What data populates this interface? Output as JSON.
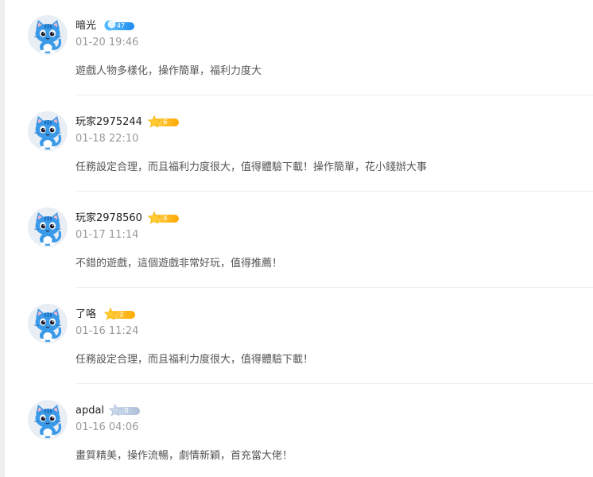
{
  "comments": [
    {
      "username": "暗光",
      "level": "47",
      "badge_style": "blue",
      "timestamp": "01-20 19:46",
      "text": "遊戲人物多樣化，操作簡單，福利力度大"
    },
    {
      "username": "玩家2975244",
      "level": "6",
      "badge_style": "gold",
      "timestamp": "01-18 22:10",
      "text": "任務設定合理，而且福利力度很大，值得體驗下載！操作簡單，花小錢辦大事"
    },
    {
      "username": "玩家2978560",
      "level": "4",
      "badge_style": "gold",
      "timestamp": "01-17 11:14",
      "text": "不錯的遊戲，這個遊戲非常好玩，值得推薦！"
    },
    {
      "username": "了咯",
      "level": "2",
      "badge_style": "gold",
      "timestamp": "01-16 11:24",
      "text": "任務設定合理，而且福利力度很大，值得體驗下載！"
    },
    {
      "username": "apdal",
      "level": "0",
      "badge_style": "gray",
      "timestamp": "01-16 04:06",
      "text": "畫質精美，操作流暢，劇情新穎，首充當大佬！"
    }
  ],
  "icons": {
    "avatar": "blue-cat-avatar-icon",
    "level_badge": "level-badge-icon"
  },
  "colors": {
    "badge_blue": "#1c8bf0",
    "badge_gold": "#ffa800",
    "badge_gray": "#aebfd8",
    "username": "#222222",
    "timestamp": "#999999",
    "comment_text": "#555555",
    "avatar_cat": "#3a9ae8"
  }
}
